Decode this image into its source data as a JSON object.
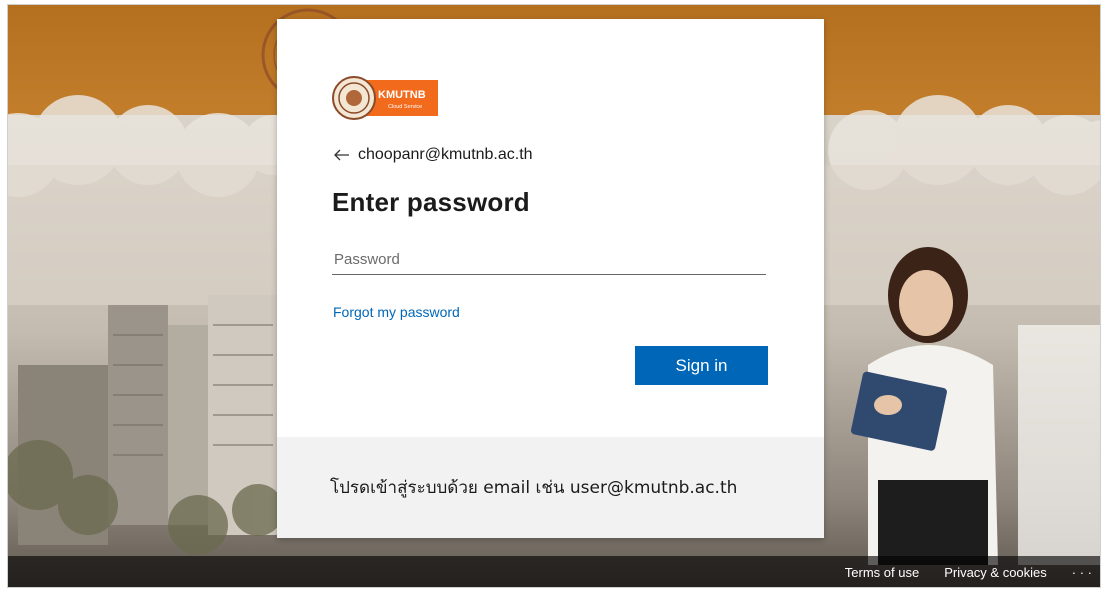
{
  "identity": {
    "email": "choopanr@kmutnb.ac.th"
  },
  "page_title": "Enter password",
  "password": {
    "placeholder": "Password",
    "value": ""
  },
  "forgot_link": "Forgot my password",
  "signin_button": "Sign in",
  "footer_note": "โปรดเข้าสู่ระบบด้วย email เช่น user@kmutnb.ac.th",
  "logo": {
    "text": "KMUTNB",
    "subtext": "Cloud Service",
    "color": "#f26a1b"
  },
  "footer": {
    "terms": "Terms of use",
    "privacy": "Privacy & cookies",
    "more": "· · ·"
  },
  "colors": {
    "accent": "#0067b8",
    "banner": "#c27d2b"
  }
}
